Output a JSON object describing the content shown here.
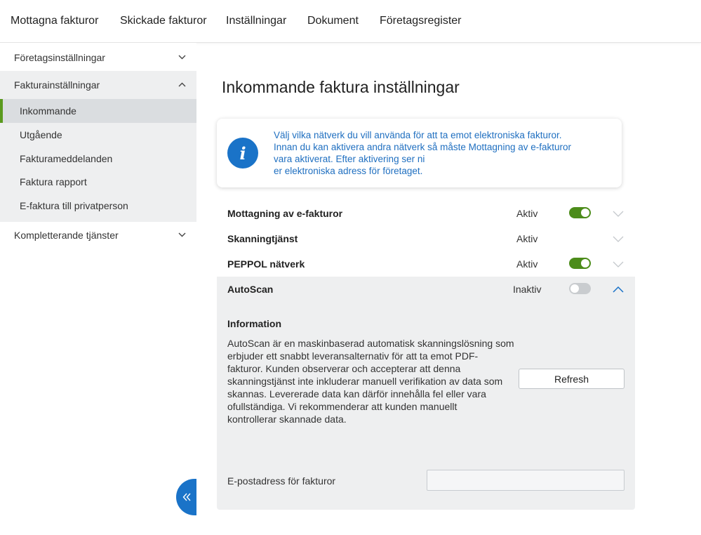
{
  "topnav": {
    "items": [
      "Mottagna fakturor",
      "Skickade fakturor",
      "Inställningar",
      "Dokument",
      "Företagsregister"
    ]
  },
  "sidebar": {
    "company_settings": "Företagsinställningar",
    "invoice_settings": "Fakturainställningar",
    "sub_items": [
      "Inkommande",
      "Utgående",
      "Fakturameddelanden",
      "Faktura rapport",
      "E-faktura till privatperson"
    ],
    "active_item": "Inkommande",
    "extra_services": "Kompletterande tjänster"
  },
  "main": {
    "title": "Inkommande faktura inställningar",
    "info_lines": [
      "Välj vilka nätverk du vill använda för att ta emot elektroniska fakturor.",
      "Innan du kan aktivera andra nätverk så måste Mottagning av e-fakturor",
      "vara aktiverat. Efter aktivering ser ni",
      "er elektroniska adress för företaget."
    ],
    "services": [
      {
        "name": "Mottagning av e-fakturor",
        "status": "Aktiv",
        "toggle": "on"
      },
      {
        "name": "Skanningtjänst",
        "status": "Aktiv",
        "toggle": "none"
      },
      {
        "name": "PEPPOL nätverk",
        "status": "Aktiv",
        "toggle": "on"
      },
      {
        "name": "AutoScan",
        "status": "Inaktiv",
        "toggle": "off"
      }
    ],
    "autoscan": {
      "section_label": "Information",
      "description_lines": [
        "AutoScan är en maskinbaserad automatisk skanningslösning som",
        "erbjuder ett snabbt leveransalternativ för att ta emot PDF-",
        "fakturor. Kunden observerar och accepterar att denna",
        "skanningstjänst inte inkluderar manuell verifikation av data som",
        "skannas. Levererade data kan därför innehålla fel eller vara",
        "ofullständiga. Vi rekommenderar att kunden manuellt",
        "kontrollerar skannade data."
      ],
      "refresh_label": "Refresh",
      "email_label": "E-postadress för fakturor",
      "email_value": ""
    }
  },
  "colors": {
    "accent_blue": "#1a73c8",
    "toggle_on": "#4c8c1a",
    "active_marker": "#5a9a1e"
  }
}
